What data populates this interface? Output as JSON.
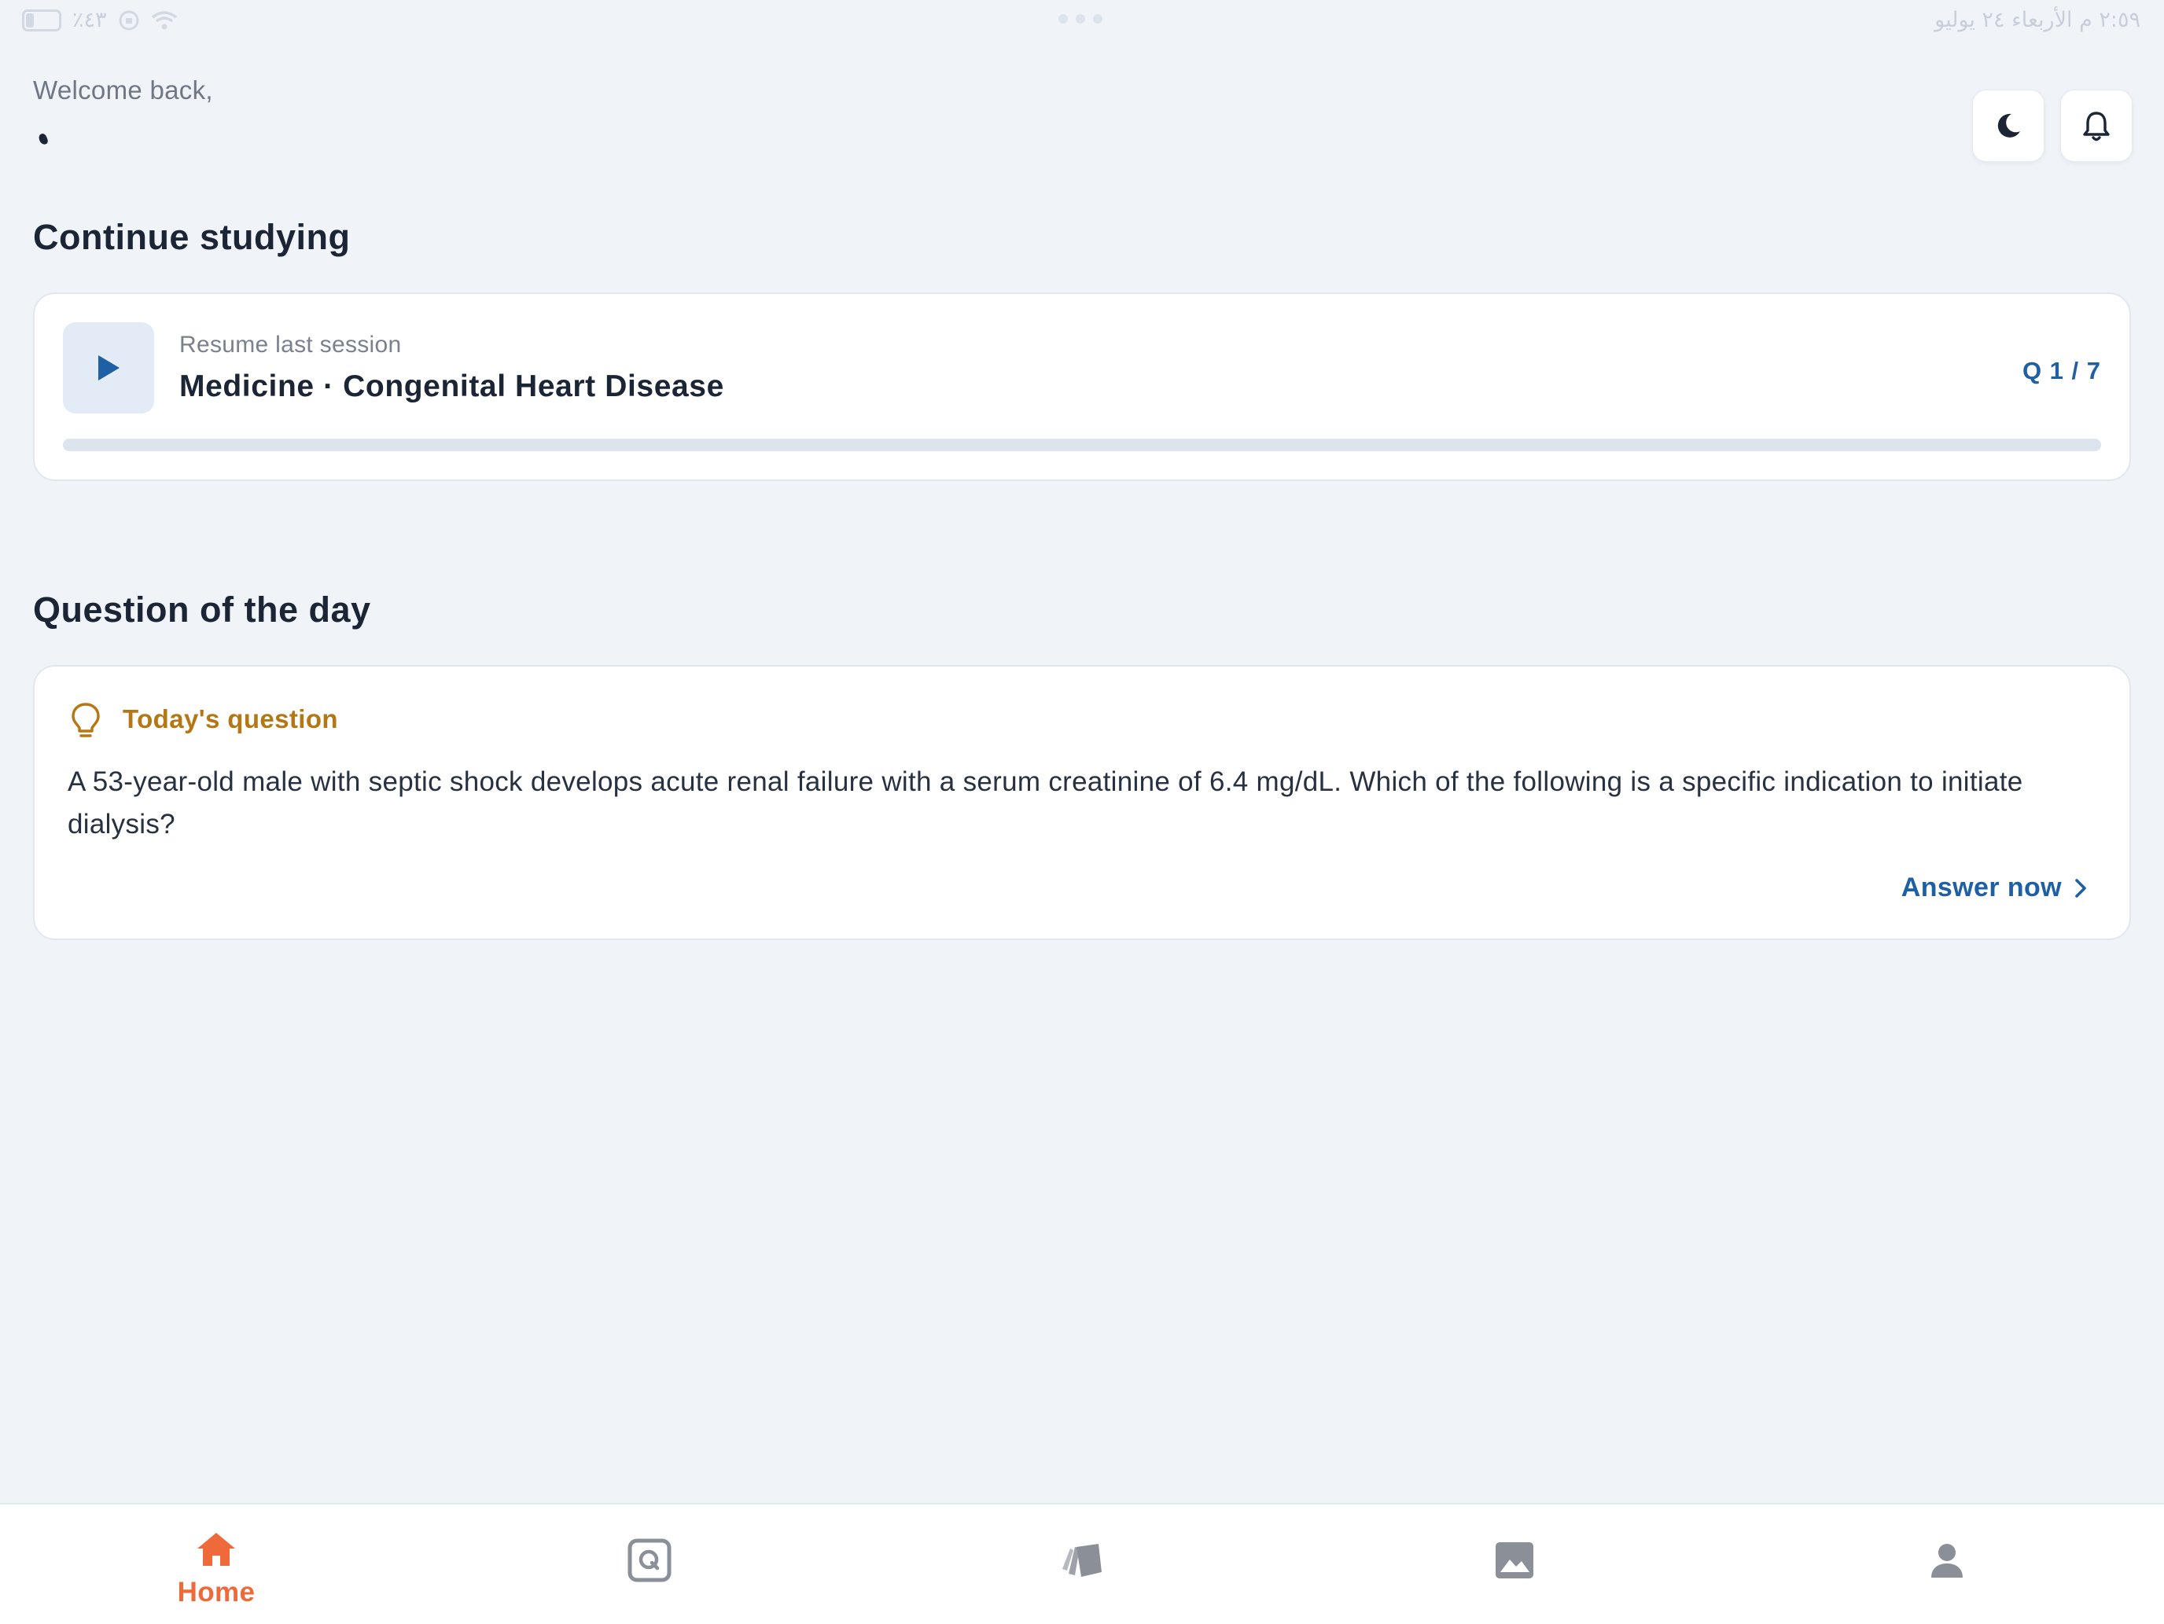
{
  "status_bar": {
    "battery_text": "٪٤٣",
    "datetime": "٢:٥٩ م   الأربعاء ٢٤ يوليو"
  },
  "header": {
    "welcome": "Welcome back,",
    "username": ""
  },
  "continue_section": {
    "title": "Continue studying",
    "resume_sub": "Resume last session",
    "resume_title": "Medicine · Congenital Heart Disease",
    "count": "Q 1 / 7",
    "progress": 0
  },
  "qotd_section": {
    "title": "Question of the day",
    "label": "Today's question",
    "question": "A 53-year-old male with septic shock develops acute renal failure with a serum creatinine of 6.4 mg/dL. Which of the following is a specific indication to initiate dialysis?",
    "answer_label": "Answer now"
  },
  "bottom_nav": {
    "home_label": "Home",
    "items": [
      "home-icon",
      "question-bank-icon",
      "flashcards-icon",
      "images-icon",
      "profile-icon"
    ],
    "active_color": "#ef6a3a",
    "inactive_color": "#8a8f98"
  },
  "colors": {
    "accent": "#1f5fa3",
    "highlight": "#b57614",
    "background": "#f0f4f9"
  }
}
